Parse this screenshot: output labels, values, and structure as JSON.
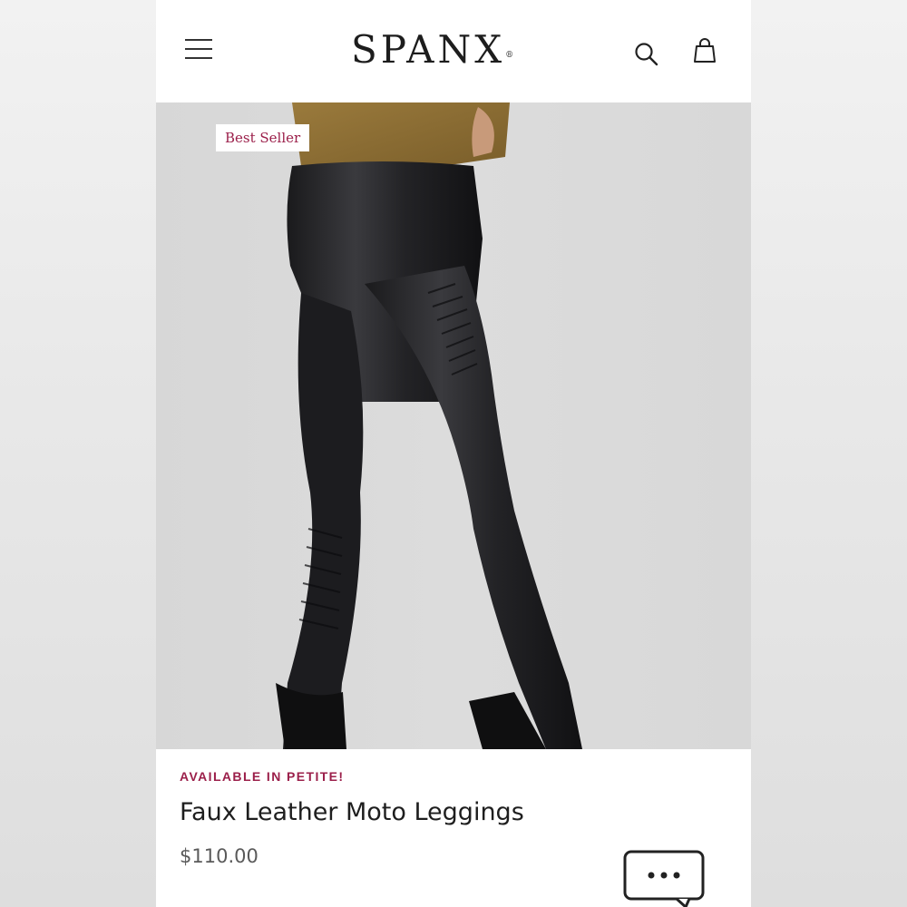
{
  "header": {
    "brand": "SPANX",
    "brand_mark": "®",
    "icons": {
      "menu": "hamburger-menu-icon",
      "search": "search-icon",
      "bag": "shopping-bag-icon"
    }
  },
  "product": {
    "badge": "Best Seller",
    "promo": "AVAILABLE IN PETITE!",
    "title": "Faux Leather Moto Leggings",
    "price": "$110.00"
  },
  "chat": {
    "icon": "chat-bubble-icon"
  },
  "colors": {
    "accent": "#9b1f4a",
    "text": "#1e1e1e",
    "price": "#5a5a5a",
    "hero_bg": "#d9d9d9"
  }
}
